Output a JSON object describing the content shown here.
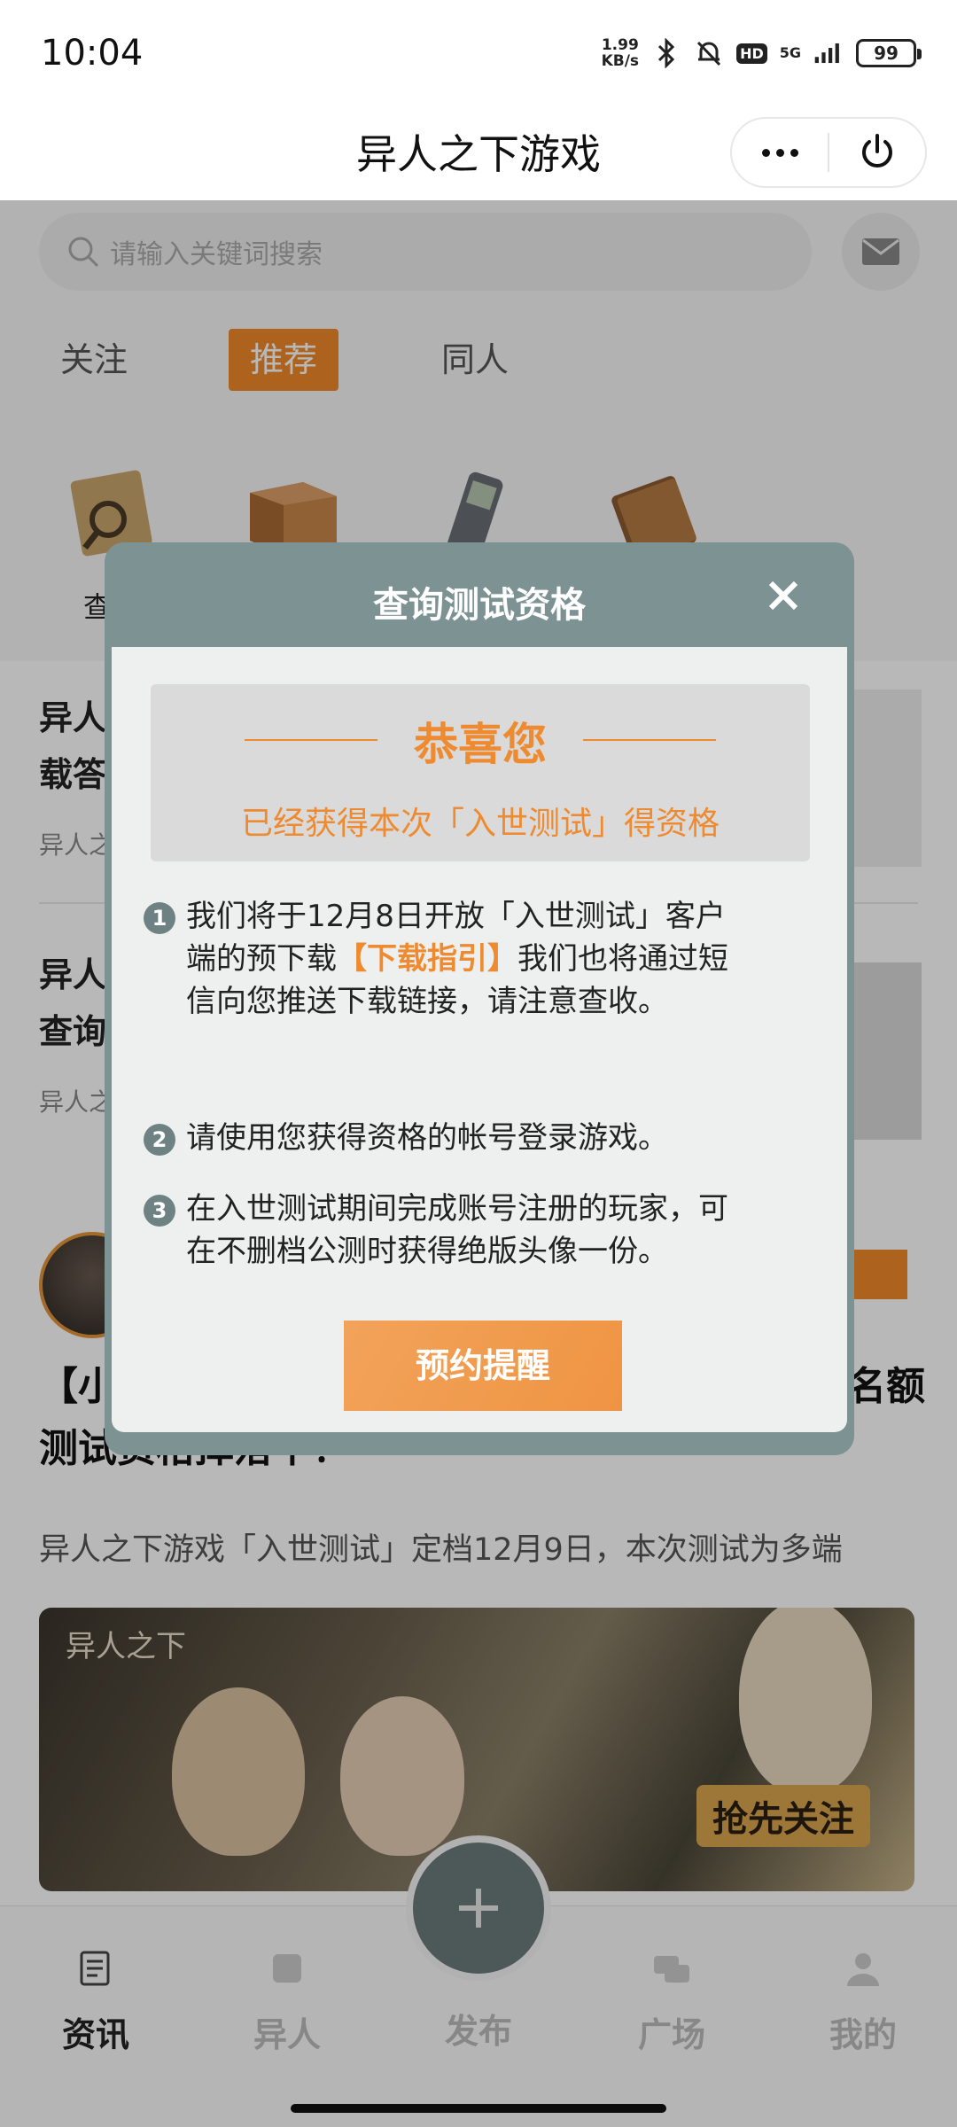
{
  "status_bar": {
    "time": "10:04",
    "net_speed_value": "1.99",
    "net_speed_unit": "KB/s",
    "hd_badge": "HD",
    "signal_label": "5G",
    "battery": "99"
  },
  "title_bar": {
    "title": "异人之下游戏",
    "more_icon": "more-dots-icon",
    "power_icon": "power-icon"
  },
  "search": {
    "placeholder": "请输入关键词搜索",
    "mail_icon": "mail-icon"
  },
  "tabs": [
    {
      "label": "关注"
    },
    {
      "label": "推荐"
    },
    {
      "label": "同人"
    }
  ],
  "quick_icons": [
    {
      "label": "查询",
      "icon": "file-magnifier-icon"
    },
    {
      "label": "",
      "icon": "box-icon"
    },
    {
      "label": "",
      "icon": "phone-icon"
    },
    {
      "label": "",
      "icon": "notebook-icon"
    }
  ],
  "news": [
    {
      "line1": "异人",
      "line2": "载答",
      "sub": "异人之"
    },
    {
      "line1": "异人",
      "line2": "查询",
      "sub": "异人之"
    }
  ],
  "post": {
    "title_line1": "【小",
    "title_line1_end": "名额",
    "title_line2": "测试资格掉落中！",
    "description": "异人之下游戏「入世测试」定档12月9日，本次测试为多端",
    "banner_logo": "异人之下",
    "banner_cta": "抢先关注"
  },
  "modal": {
    "title": "查询测试资格",
    "close_icon": "close-icon",
    "congrats_title": "恭喜您",
    "congrats_sub": "已经获得本次「入世测试」得资格",
    "items": [
      {
        "num": "1",
        "text_before": "我们将于12月8日开放「入世测试」客户端的预下载",
        "link": "【下载指引】",
        "text_after": "我们也将通过短信向您推送下载链接，请注意查收。"
      },
      {
        "num": "2",
        "text": "请使用您获得资格的帐号登录游戏。"
      },
      {
        "num": "3",
        "text": "在入世测试期间完成账号注册的玩家，可在不删档公测时获得绝版头像一份。"
      }
    ],
    "button": "预约提醒"
  },
  "tab_bar": [
    {
      "label": "资讯",
      "icon": "news-icon",
      "active": true
    },
    {
      "label": "异人",
      "icon": "scroll-icon",
      "active": false
    },
    {
      "label": "发布",
      "icon": "plus-icon",
      "active": false
    },
    {
      "label": "广场",
      "icon": "chat-icon",
      "active": false
    },
    {
      "label": "我的",
      "icon": "user-icon",
      "active": false
    }
  ],
  "colors": {
    "accent": "#ee8a2f",
    "modal_frame": "#7d9293",
    "modal_body": "#eef0f0"
  }
}
